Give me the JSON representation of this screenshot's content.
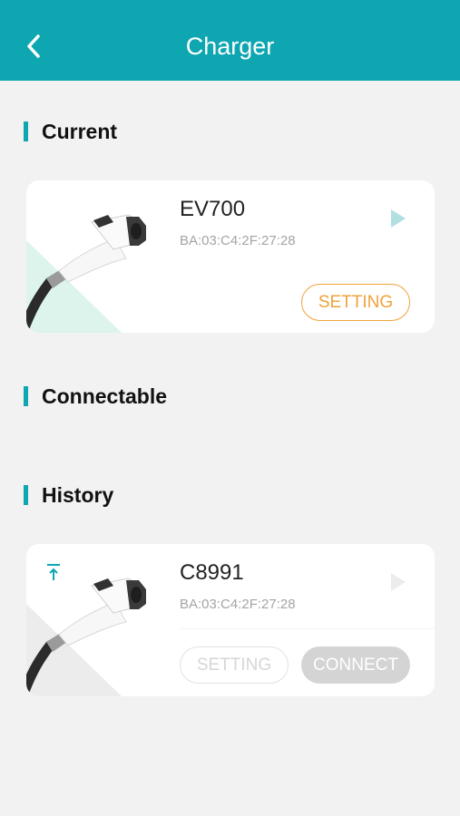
{
  "header": {
    "title": "Charger"
  },
  "sections": {
    "current": "Current",
    "connectable": "Connectable",
    "history": "History"
  },
  "current_charger": {
    "name": "EV700",
    "mac": "BA:03:C4:2F:27:28",
    "setting_label": "SETTING"
  },
  "history_charger": {
    "name": "C8991",
    "mac": "BA:03:C4:2F:27:28",
    "setting_label": "SETTING",
    "connect_label": "CONNECT"
  },
  "icons": {
    "back": "chevron-left-icon",
    "arrow": "triangle-right-icon",
    "pin": "pin-to-top-icon"
  },
  "colors": {
    "accent": "#0ea6b1",
    "setting_orange": "#f0a23b",
    "mint": "#dff5ef"
  }
}
